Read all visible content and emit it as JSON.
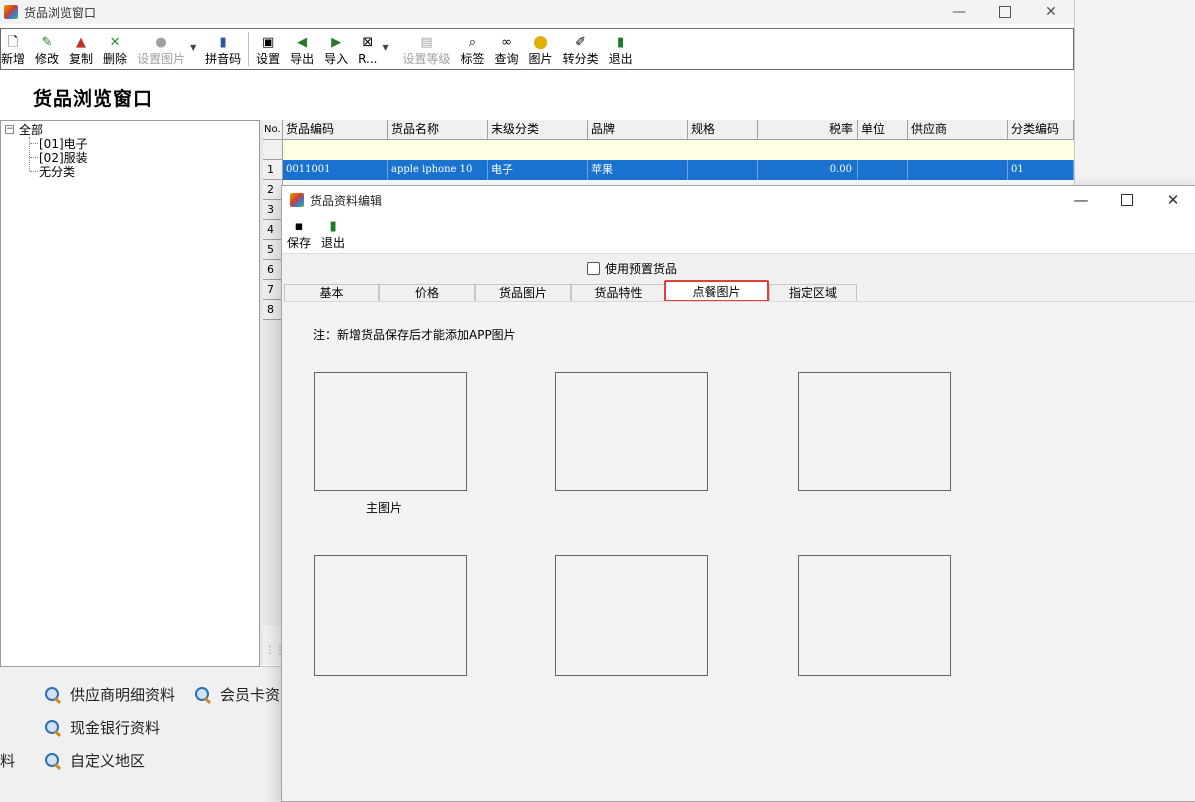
{
  "main_window": {
    "title": "货品浏览窗口",
    "heading": "货品浏览窗口",
    "toolbar": [
      {
        "label": "新增",
        "icon": "new-document-icon",
        "enabled": true
      },
      {
        "label": "修改",
        "icon": "edit-icon",
        "enabled": true
      },
      {
        "label": "复制",
        "icon": "copy-stamp-icon",
        "enabled": true
      },
      {
        "label": "删除",
        "icon": "delete-x-icon",
        "enabled": true
      },
      {
        "label": "设置图片",
        "icon": "image-set-icon",
        "enabled": false
      },
      {
        "label": "拼音码",
        "icon": "pinyin-icon",
        "enabled": true
      },
      {
        "label": "设置",
        "icon": "settings-icon",
        "enabled": true
      },
      {
        "label": "导出",
        "icon": "export-icon",
        "enabled": true
      },
      {
        "label": "导入",
        "icon": "import-icon",
        "enabled": true
      },
      {
        "label": "R...",
        "icon": "report-icon",
        "enabled": true
      },
      {
        "label": "设置等级",
        "icon": "grade-icon",
        "enabled": false
      },
      {
        "label": "标签",
        "icon": "label-icon",
        "enabled": true
      },
      {
        "label": "查询",
        "icon": "binoculars-icon",
        "enabled": true
      },
      {
        "label": "图片",
        "icon": "picture-icon",
        "enabled": true
      },
      {
        "label": "转分类",
        "icon": "transfer-category-icon",
        "enabled": true
      },
      {
        "label": "退出",
        "icon": "exit-icon",
        "enabled": true
      }
    ],
    "tree": {
      "root": "全部",
      "children": [
        "[01]电子",
        "[02]服装",
        "无分类"
      ]
    },
    "grid": {
      "columns": [
        "No.",
        "货品编码",
        "货品名称",
        "末级分类",
        "品牌",
        "规格",
        "税率",
        "单位",
        "供应商",
        "分类编码"
      ],
      "row_numbers": [
        "1",
        "2",
        "3",
        "4",
        "5",
        "6",
        "7",
        "8"
      ],
      "selected_row": {
        "code": "0011001",
        "name": "apple iphone 10",
        "category": "电子",
        "brand": "苹果",
        "spec": "",
        "tax": "0.00",
        "unit": "",
        "supplier": "",
        "class_code": "01"
      }
    }
  },
  "background_links": [
    {
      "label": "供应商明细资料"
    },
    {
      "label": "会员卡资"
    },
    {
      "label": "现金银行资料"
    },
    {
      "label": "自定义地区"
    },
    {
      "label": "料"
    }
  ],
  "dialog": {
    "title": "货品资料编辑",
    "toolbar": [
      {
        "label": "保存",
        "icon": "save-disk-icon"
      },
      {
        "label": "退出",
        "icon": "exit-icon"
      }
    ],
    "checkbox_label": "使用预置货品",
    "checkbox_checked": false,
    "tabs": [
      {
        "label": "基本",
        "active": false
      },
      {
        "label": "价格",
        "active": false
      },
      {
        "label": "货品图片",
        "active": false
      },
      {
        "label": "货品特性",
        "active": false
      },
      {
        "label": "点餐图片",
        "active": true
      },
      {
        "label": "指定区域",
        "active": false
      }
    ],
    "note": "注：新增货品保存后才能添加APP图片",
    "main_image_caption": "主图片"
  },
  "colors": {
    "selection": "#1a73d1",
    "filter_row": "#ffffe1",
    "active_tab_highlight": "#e0403a"
  }
}
